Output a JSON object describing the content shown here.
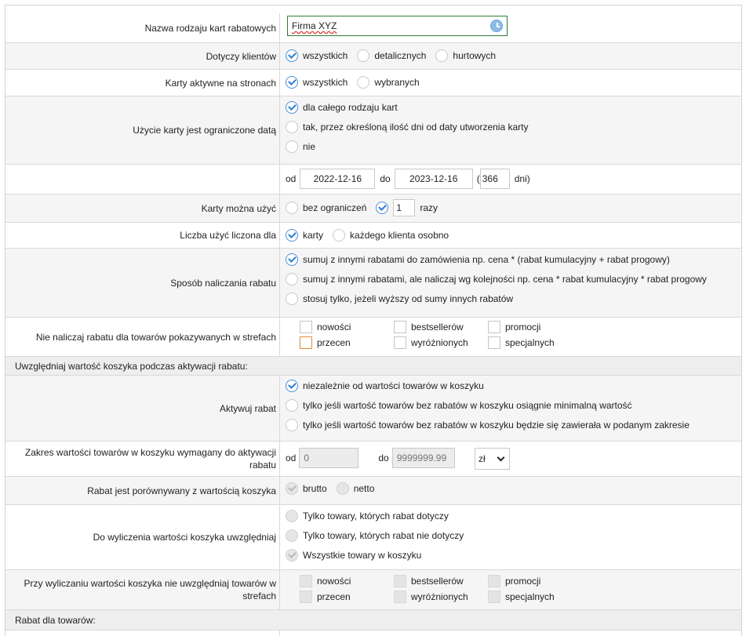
{
  "name_row": {
    "label": "Nazwa rodzaju kart rabatowych",
    "value": "Firma XYZ"
  },
  "clients_row": {
    "label": "Dotyczy klientów",
    "options": [
      "wszystkich",
      "detalicznych",
      "hurtowych"
    ],
    "selected": 0
  },
  "active_row": {
    "label": "Karty aktywne na stronach",
    "options": [
      "wszystkich",
      "wybranych"
    ],
    "selected": 0
  },
  "date_limit_row": {
    "label": "Użycie karty jest ograniczone datą",
    "options": [
      "dla całego rodzaju kart",
      "tak, przez określoną ilość dni od daty utworzenia karty",
      "nie"
    ],
    "selected": 0
  },
  "date_range_row": {
    "from_label": "od",
    "from_value": "2022-12-16",
    "to_label": "do",
    "to_value": "2023-12-16",
    "open_paren": "(",
    "days_value": "366",
    "days_label": "dni)"
  },
  "usage_row": {
    "label": "Karty można użyć",
    "option_unlimited": "bez ograniczeń",
    "count_value": "1",
    "count_unit": "razy",
    "selected": 1
  },
  "usage_count_row": {
    "label": "Liczba użyć liczona dla",
    "options": [
      "karty",
      "każdego klienta osobno"
    ],
    "selected": 0
  },
  "calc_row": {
    "label": "Sposób naliczania rabatu",
    "options": [
      "sumuj z innymi rabatami do zamówienia np. cena * (rabat kumulacyjny + rabat progowy)",
      "sumuj z innymi rabatami, ale naliczaj wg kolejności np. cena * rabat kumulacyjny * rabat progowy",
      "stosuj tylko, jeżeli wyższy od sumy innych rabatów"
    ],
    "selected": 0
  },
  "zones_row": {
    "label": "Nie naliczaj rabatu dla towarów pokazywanych w strefach",
    "items": [
      "nowości",
      "bestsellerów",
      "promocji",
      "przecen",
      "wyróżnionych",
      "specjalnych"
    ]
  },
  "section_cart": {
    "title": "Uwzględniaj wartość koszyka podczas aktywacji rabatu:"
  },
  "activate_row": {
    "label": "Aktywuj rabat",
    "options": [
      "niezależnie od wartości towarów w koszyku",
      "tylko jeśli wartość towarów bez rabatów w koszyku osiągnie minimalną wartość",
      "tylko jeśli wartość towarów bez rabatów w koszyku będzie się zawierała w podanym zakresie"
    ],
    "selected": 0
  },
  "cart_range_row": {
    "label": "Zakres wartości towarów w koszyku wymagany do aktywacji rabatu",
    "from_label": "od",
    "from_placeholder": "0",
    "to_label": "do",
    "to_placeholder": "9999999.99",
    "currency": "zł"
  },
  "compare_row": {
    "label": "Rabat jest porównywany z wartością koszyka",
    "options": [
      "brutto",
      "netto"
    ],
    "selected": 0
  },
  "cart_calc_row": {
    "label": "Do wyliczenia wartości koszyka uwzględniaj",
    "options": [
      "Tylko towary, których rabat dotyczy",
      "Tylko towary, których rabat nie dotyczy",
      "Wszystkie towary w koszyku"
    ],
    "selected": 2
  },
  "cart_zones_row": {
    "label": "Przy wyliczaniu wartości koszyka nie uwzględniaj towarów w strefach",
    "items": [
      "nowości",
      "bestsellerów",
      "promocji",
      "przecen",
      "wyróżnionych",
      "specjalnych"
    ]
  },
  "section_products": {
    "title": "Rabat dla towarów:"
  },
  "colors": {
    "accent": "#2b7bd1",
    "name_border": "#2e7d32",
    "orange_box": "#e58a3a"
  }
}
